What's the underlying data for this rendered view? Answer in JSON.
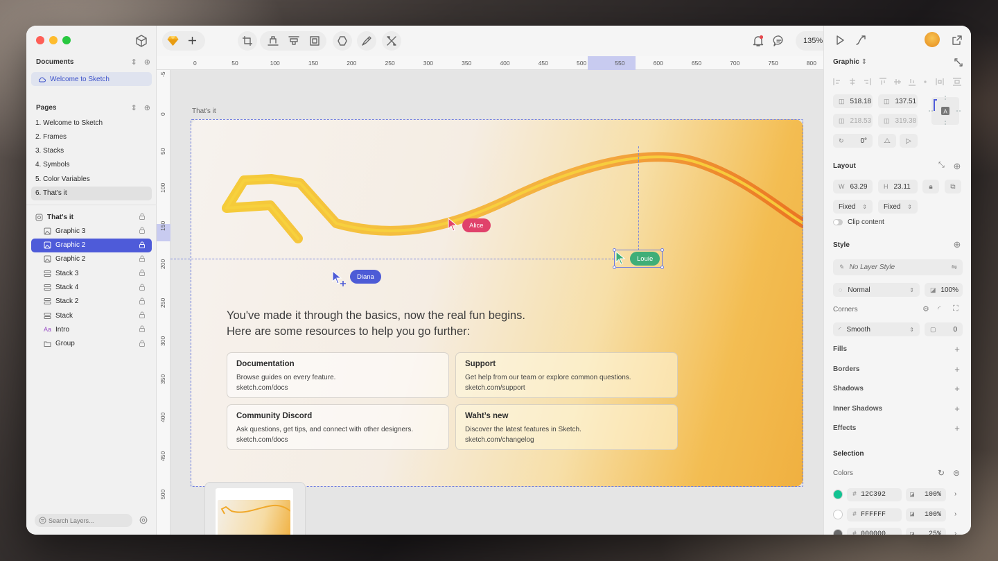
{
  "sidebar": {
    "documents_header": "Documents",
    "document_item": "Welcome to Sketch",
    "pages_header": "Pages",
    "pages": [
      "1. Welcome to Sketch",
      "2. Frames",
      "3. Stacks",
      "4. Symbols",
      "5. Color Variables",
      "6. That's it"
    ],
    "selected_page": 5,
    "layers": [
      {
        "label": "That's it",
        "icon": "artboard-icon",
        "root": true
      },
      {
        "label": "Graphic 3",
        "icon": "image-icon"
      },
      {
        "label": "Graphic 2",
        "icon": "image-icon",
        "selected": true
      },
      {
        "label": "Graphic 2",
        "icon": "image-icon"
      },
      {
        "label": "Stack 3",
        "icon": "stack-icon"
      },
      {
        "label": "Stack 4",
        "icon": "stack-icon"
      },
      {
        "label": "Stack 2",
        "icon": "stack-icon"
      },
      {
        "label": "Stack",
        "icon": "stack-icon"
      },
      {
        "label": "Intro",
        "icon": "text-icon"
      },
      {
        "label": "Group",
        "icon": "folder-icon"
      }
    ],
    "search_placeholder": "Search Layers..."
  },
  "toolbar": {
    "zoom": "135%"
  },
  "rulers": {
    "top": [
      "0",
      "50",
      "100",
      "150",
      "200",
      "250",
      "300",
      "350",
      "400",
      "450",
      "500",
      "550",
      "600",
      "650",
      "700",
      "750",
      "800"
    ],
    "left": [
      "-5",
      "0",
      "50",
      "100",
      "150",
      "200",
      "250",
      "300",
      "350",
      "400",
      "450",
      "500"
    ]
  },
  "canvas": {
    "artboard_label": "That's it",
    "headline_1": "You've made it through the basics, now the real fun begins.",
    "headline_2": "Here are some resources to help you go further:",
    "cards": [
      {
        "title": "Documentation",
        "desc": "Browse guides on every feature.",
        "link": "sketch.com/docs"
      },
      {
        "title": "Support",
        "desc": "Get help from our team or explore common questions.",
        "link": "sketch.com/support"
      },
      {
        "title": "Community Discord",
        "desc": "Ask questions, get tips, and connect with other designers.",
        "link": "sketch.com/docs"
      },
      {
        "title": "Waht’s new",
        "desc": "Discover the latest features in Sketch.",
        "link": "sketch.com/changelog"
      }
    ],
    "cursors": [
      {
        "name": "Alice",
        "color": "#e0426b"
      },
      {
        "name": "Diana",
        "color": "#4d5bd6"
      },
      {
        "name": "Louie",
        "color": "#3fae78"
      }
    ]
  },
  "inspector": {
    "title": "Graphic",
    "x": "518.18",
    "y": "137.51",
    "x2": "218.53",
    "y2": "319.38",
    "rotation": "0°",
    "layout_header": "Layout",
    "w_label": "W",
    "w": "63.29",
    "h_label": "H",
    "h": "23.11",
    "sizing_h": "Fixed",
    "sizing_v": "Fixed",
    "clip_content": "Clip content",
    "style_header": "Style",
    "layer_style": "No Layer Style",
    "blend_mode": "Normal",
    "opacity": "100%",
    "corners_label": "Corners",
    "corner_style": "Smooth",
    "corner_radius": "0",
    "fills": "Fills",
    "borders": "Borders",
    "shadows": "Shadows",
    "inner_shadows": "Inner Shadows",
    "effects": "Effects",
    "selection_header": "Selection",
    "colors_label": "Colors",
    "colors": [
      {
        "hex": "12C392",
        "opacity": "100%",
        "swatch": "#12c392"
      },
      {
        "hex": "FFFFFF",
        "opacity": "100%",
        "swatch": "#ffffff"
      },
      {
        "hex": "000000",
        "opacity": "25%",
        "swatch": "#6a6a6a"
      }
    ]
  }
}
